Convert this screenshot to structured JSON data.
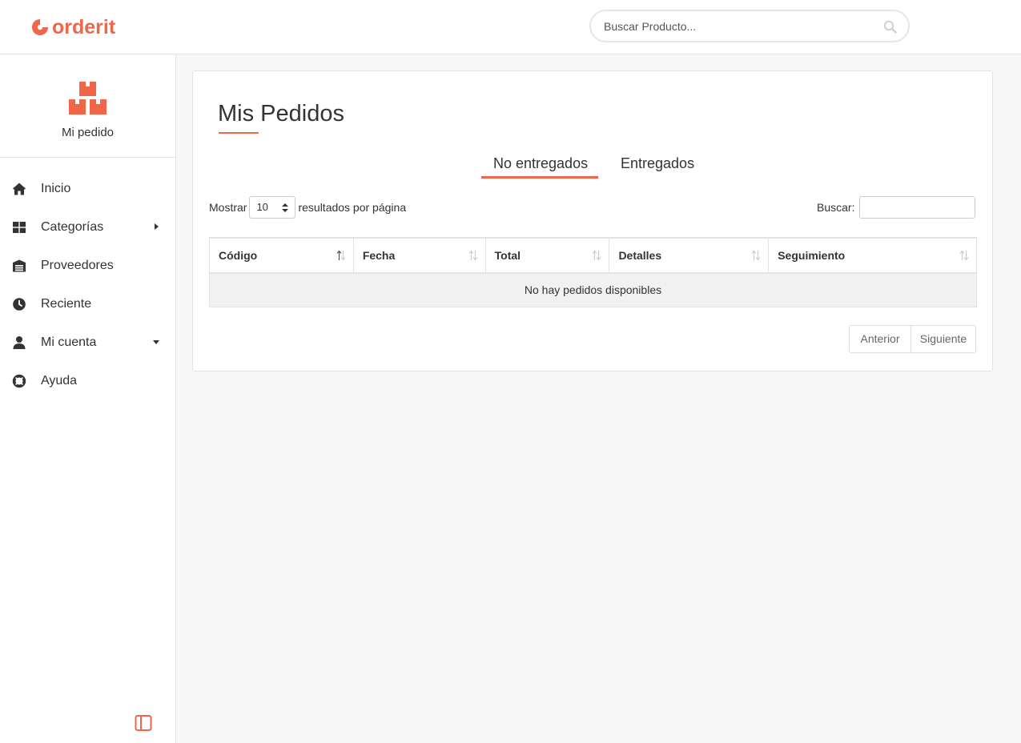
{
  "brand": {
    "name": "orderit",
    "color": "#ef6648"
  },
  "search": {
    "placeholder": "Buscar Producto..."
  },
  "sidebar": {
    "order_label": "Mi pedido",
    "items": [
      {
        "label": "Inicio",
        "icon": "home-icon"
      },
      {
        "label": "Categorías",
        "icon": "grid-icon",
        "caret": "right"
      },
      {
        "label": "Proveedores",
        "icon": "warehouse-icon"
      },
      {
        "label": "Reciente",
        "icon": "clock-icon"
      },
      {
        "label": "Mi cuenta",
        "icon": "user-icon",
        "caret": "down"
      },
      {
        "label": "Ayuda",
        "icon": "lifebuoy-icon"
      }
    ]
  },
  "main": {
    "title": "Mis Pedidos",
    "tabs": [
      {
        "label": "No entregados",
        "active": true
      },
      {
        "label": "Entregados",
        "active": false
      }
    ],
    "length_prefix": "Mostrar",
    "length_value": "10",
    "length_suffix": "resultados por página",
    "filter_label": "Buscar:",
    "table": {
      "columns": [
        "Código",
        "Fecha",
        "Total",
        "Detalles",
        "Seguimiento"
      ],
      "empty_message": "No hay pedidos disponibles"
    },
    "pagination": {
      "prev": "Anterior",
      "next": "Siguiente"
    }
  }
}
